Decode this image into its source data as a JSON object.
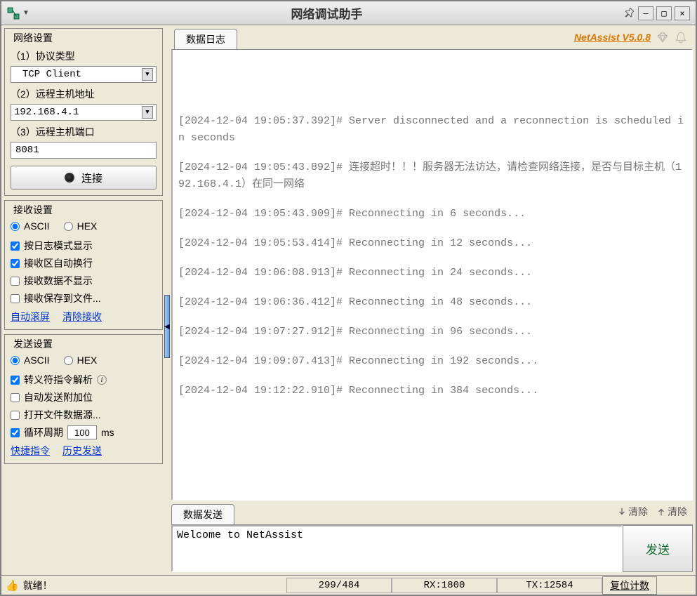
{
  "window": {
    "title": "网络调试助手"
  },
  "network": {
    "legend": "网络设置",
    "protocol_label": "（1）协议类型",
    "protocol_value": "TCP Client",
    "host_label": "（2）远程主机地址",
    "host_value": "192.168.4.1",
    "port_label": "（3）远程主机端口",
    "port_value": "8081",
    "connect_label": "连接"
  },
  "recv": {
    "legend": "接收设置",
    "ascii": "ASCII",
    "hex": "HEX",
    "log_mode": "按日志模式显示",
    "auto_wrap": "接收区自动换行",
    "hide_data": "接收数据不显示",
    "save_file": "接收保存到文件...",
    "auto_scroll": "自动滚屏",
    "clear_recv": "清除接收"
  },
  "send": {
    "legend": "发送设置",
    "ascii": "ASCII",
    "hex": "HEX",
    "escape": "转义符指令解析",
    "auto_append": "自动发送附加位",
    "open_file": "打开文件数据源...",
    "loop_label": "循环周期",
    "loop_value": "100",
    "loop_unit": "ms",
    "shortcut": "快捷指令",
    "history": "历史发送"
  },
  "log_tab": "数据日志",
  "version": "NetAssist V5.0.8",
  "log_lines": [
    "[2024-12-04 19:05:37.392]# Server disconnected and a reconnection is scheduled in seconds",
    "[2024-12-04 19:05:43.892]# 连接超时！！！服务器无法访达，请检查网络连接，是否与目标主机（192.168.4.1）在同一网络",
    "[2024-12-04 19:05:43.909]# Reconnecting in 6 seconds...",
    "[2024-12-04 19:05:53.414]# Reconnecting in 12 seconds...",
    "[2024-12-04 19:06:08.913]# Reconnecting in 24 seconds...",
    "[2024-12-04 19:06:36.412]# Reconnecting in 48 seconds...",
    "[2024-12-04 19:07:27.912]# Reconnecting in 96 seconds...",
    "[2024-12-04 19:09:07.413]# Reconnecting in 192 seconds...",
    "[2024-12-04 19:12:22.910]# Reconnecting in 384 seconds..."
  ],
  "send_tab": "数据发送",
  "send_clear1": "清除",
  "send_clear2": "清除",
  "send_text": "Welcome to NetAssist",
  "send_button": "发送",
  "status": {
    "ready": "就绪！",
    "counts": "299/484",
    "rx": "RX:1800",
    "tx": "TX:12584",
    "reset": "复位计数"
  }
}
